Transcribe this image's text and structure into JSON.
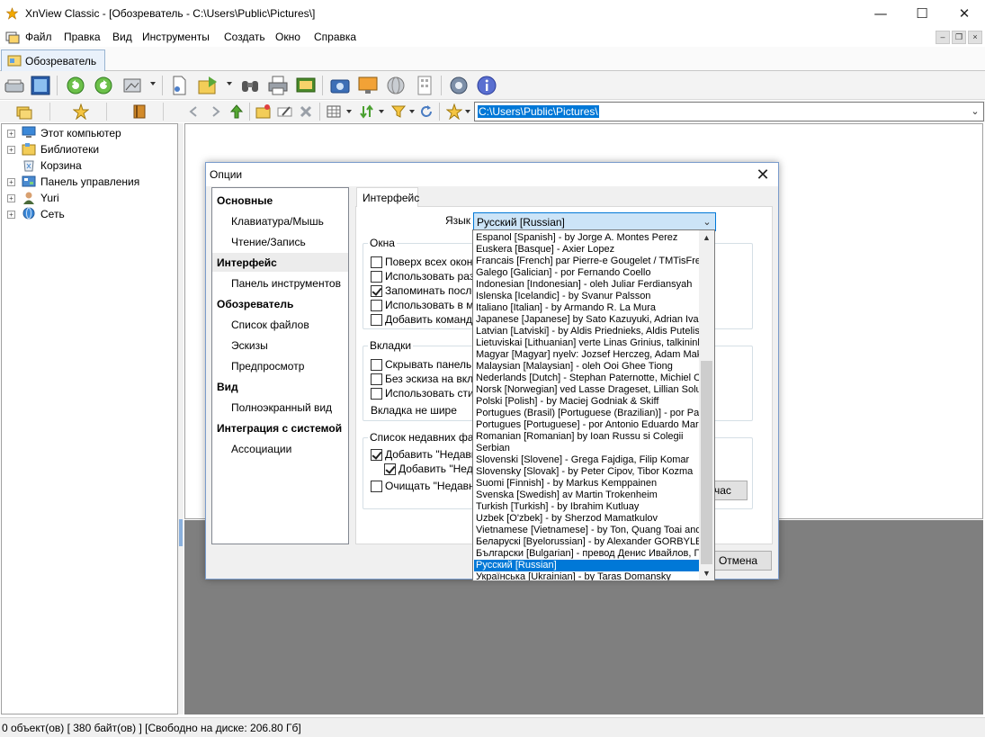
{
  "window": {
    "title": "XnView Classic - [Обозреватель - C:\\Users\\Public\\Pictures\\]",
    "icon": "xnview-logo-icon",
    "controls": [
      "minimize",
      "maximize",
      "close"
    ]
  },
  "menu": [
    "Файл",
    "Правка",
    "Вид",
    "Инструменты",
    "Создать",
    "Окно",
    "Справка"
  ],
  "tab": {
    "label": "Обозреватель"
  },
  "address": {
    "path": "C:\\Users\\Public\\Pictures\\"
  },
  "tree": [
    {
      "label": "Этот компьютер",
      "icon": "computer-icon"
    },
    {
      "label": "Библиотеки",
      "icon": "libraries-icon"
    },
    {
      "label": "Корзина",
      "icon": "recycle-bin-icon"
    },
    {
      "label": "Панель управления",
      "icon": "control-panel-icon"
    },
    {
      "label": "Yuri",
      "icon": "user-icon"
    },
    {
      "label": "Сеть",
      "icon": "network-icon"
    }
  ],
  "status": {
    "text": "0 объект(ов) [ 380 байт(ов) ] [Свободно на диске: 206.80 Гб]"
  },
  "dialog": {
    "title": "Опции",
    "nav": [
      {
        "label": "Основные",
        "type": "cat"
      },
      {
        "label": "Клавиатура/Мышь",
        "type": "sub"
      },
      {
        "label": "Чтение/Запись",
        "type": "sub"
      },
      {
        "label": "Интерфейс",
        "type": "cat",
        "selected": true
      },
      {
        "label": "Панель инструментов",
        "type": "sub"
      },
      {
        "label": "Обозреватель",
        "type": "cat"
      },
      {
        "label": "Список файлов",
        "type": "sub"
      },
      {
        "label": "Эскизы",
        "type": "sub"
      },
      {
        "label": "Предпросмотр",
        "type": "sub"
      },
      {
        "label": "Вид",
        "type": "cat"
      },
      {
        "label": "Полноэкранный вид",
        "type": "sub"
      },
      {
        "label": "Интеграция с системой",
        "type": "cat"
      },
      {
        "label": "Ассоциации",
        "type": "sub"
      }
    ],
    "tab": "Интерфейс",
    "language_label": "Язык",
    "language_value": "Русский [Russian]",
    "windows_group": {
      "title": "Окна",
      "items": [
        {
          "label": "Поверх всех окон",
          "checked": false
        },
        {
          "label": "Использовать разн",
          "checked": false
        },
        {
          "label": "Запоминать послед",
          "checked": true
        },
        {
          "label": "Использовать в ме",
          "checked": false
        },
        {
          "label": "Добавить команду",
          "checked": false
        }
      ]
    },
    "tabs_group": {
      "title": "Вкладки",
      "items": [
        {
          "label": "Скрывать панель в",
          "checked": false
        },
        {
          "label": "Без эскиза на вкла",
          "checked": false
        },
        {
          "label": "Использовать стил",
          "checked": false
        }
      ],
      "width_label": "Вкладка не шире"
    },
    "recent_group": {
      "title": "Список недавних файл",
      "items": [
        {
          "label": "Добавить \"Недавни",
          "checked": true
        },
        {
          "label": "Добавить \"Недав",
          "checked": true
        },
        {
          "label": "Очищать \"Недавние",
          "checked": false
        }
      ],
      "button_partial": "час"
    },
    "cancel_button": "Отмена",
    "language_list": [
      "Espanol [Spanish] - by Jorge A. Montes Perez",
      "Euskera [Basque] - Axier Lopez",
      "Francais [French] par Pierre-e Gougelet / TMTisFree",
      "Galego [Galician] - por Fernando Coello",
      "Indonesian [Indonesian] - oleh Juliar Ferdiansyah",
      "Islenska [Icelandic] - by Svanur Palsson",
      "Italiano [Italian] - by Armando R. La Mura",
      "Japanese [Japanese] by Sato Kazuyuki, Adrian Ivana",
      "Latvian [Latviski] - by Aldis Priednieks, Aldis Putelis",
      "Lietuviskai [Lithuanian] verte Linas Grinius, talkininka",
      "Magyar [Magyar] nyelv: Jozsef Herczeg, Adam Mako",
      "Malaysian [Malaysian] - oleh Ooi Ghee Tiong",
      "Nederlands [Dutch] - Stephan Paternotte, Michiel Oo",
      "Norsk [Norwegian] ved Lasse Drageset, Lillian Solum",
      "Polski [Polish] - by Maciej Godniak & Skiff",
      "Portugues (Brasil) [Portuguese (Brazilian)] - por Paulo",
      "Portugues [Portuguese] - por Antonio Eduardo Marqu",
      "Romanian [Romanian] by Ioan Russu si Colegii",
      "Serbian",
      "Slovenski [Slovene] - Grega Fajdiga, Filip Komar",
      "Slovensky [Slovak] - by Peter Cipov, Tibor Kozma",
      "Suomi [Finnish] - by Markus Kemppainen",
      "Svenska [Swedish] av Martin Trokenheim",
      "Turkish [Turkish] - by Ibrahim Kutluay",
      "Uzbek [O'zbek] - by Sherzod Mamatkulov",
      "Vietnamese [Vietnamese] - by Ton, Quang Toai and V",
      "Беларускі [Byelorussian] - by Alexander GORBYLEV",
      "Български [Bulgarian] - превод Денис Ивайлов, Ге",
      "Русский [Russian]",
      "Українська [Ukrainian] - by Taras Domansky"
    ],
    "selected_language_index": 28
  },
  "colors": {
    "accent": "#0078d7",
    "preview_bg": "#7f7f7f"
  }
}
